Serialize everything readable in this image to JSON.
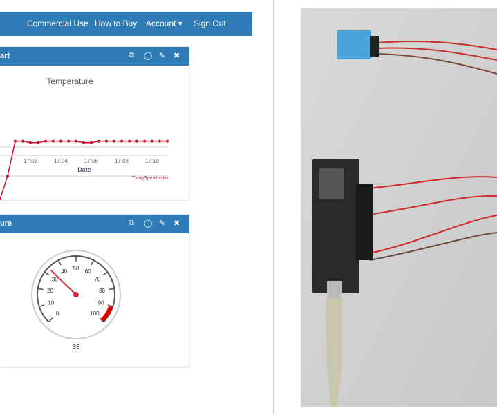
{
  "nav": {
    "items": [
      {
        "label": "Commercial Use"
      },
      {
        "label": "How to Buy"
      },
      {
        "label": "Account ▾"
      },
      {
        "label": "Sign Out"
      }
    ]
  },
  "chart_panel": {
    "title": "art",
    "icons": [
      "external-link-icon",
      "comment-icon",
      "pencil-icon",
      "close-icon"
    ],
    "icon_glyphs": [
      "⧉",
      "◯",
      "✎",
      "✖"
    ]
  },
  "gauge_panel": {
    "title": "ure",
    "icons": [
      "external-link-icon",
      "comment-icon",
      "pencil-icon",
      "close-icon"
    ],
    "icon_glyphs": [
      "⧉",
      "◯",
      "✎",
      "✖"
    ]
  },
  "chart_data": {
    "type": "line",
    "title": "Temperature",
    "xlabel": "Date",
    "ylabel": "",
    "credit": "ThingSpeak.com",
    "x_ticks": [
      "17:02",
      "17:04",
      "17:06",
      "17:08",
      "17:10"
    ],
    "x": [
      "17:00:00",
      "17:00:30",
      "17:01:00",
      "17:01:30",
      "17:02:00",
      "17:02:30",
      "17:03:00",
      "17:03:30",
      "17:04:00",
      "17:04:30",
      "17:05:00",
      "17:05:30",
      "17:06:00",
      "17:06:30",
      "17:07:00",
      "17:07:30",
      "17:08:00",
      "17:08:30",
      "17:09:00",
      "17:09:30",
      "17:10:00",
      "17:10:30",
      "17:11:00"
    ],
    "values": [
      12,
      20,
      32,
      32,
      31.5,
      31.5,
      32,
      32,
      32,
      32,
      32,
      31.5,
      31.5,
      32,
      32,
      32,
      32,
      32,
      32,
      32,
      32,
      32,
      32
    ],
    "grid_values": [
      20,
      30
    ],
    "color": "#c8102e",
    "grid": true
  },
  "gauge": {
    "value": 33,
    "display": "33",
    "min": 0,
    "max": 100,
    "ticks": [
      0,
      10,
      20,
      30,
      40,
      50,
      60,
      70,
      80,
      90,
      100
    ],
    "danger_from": 90,
    "danger_color": "#e00000",
    "needle_color": "#d9263a"
  }
}
